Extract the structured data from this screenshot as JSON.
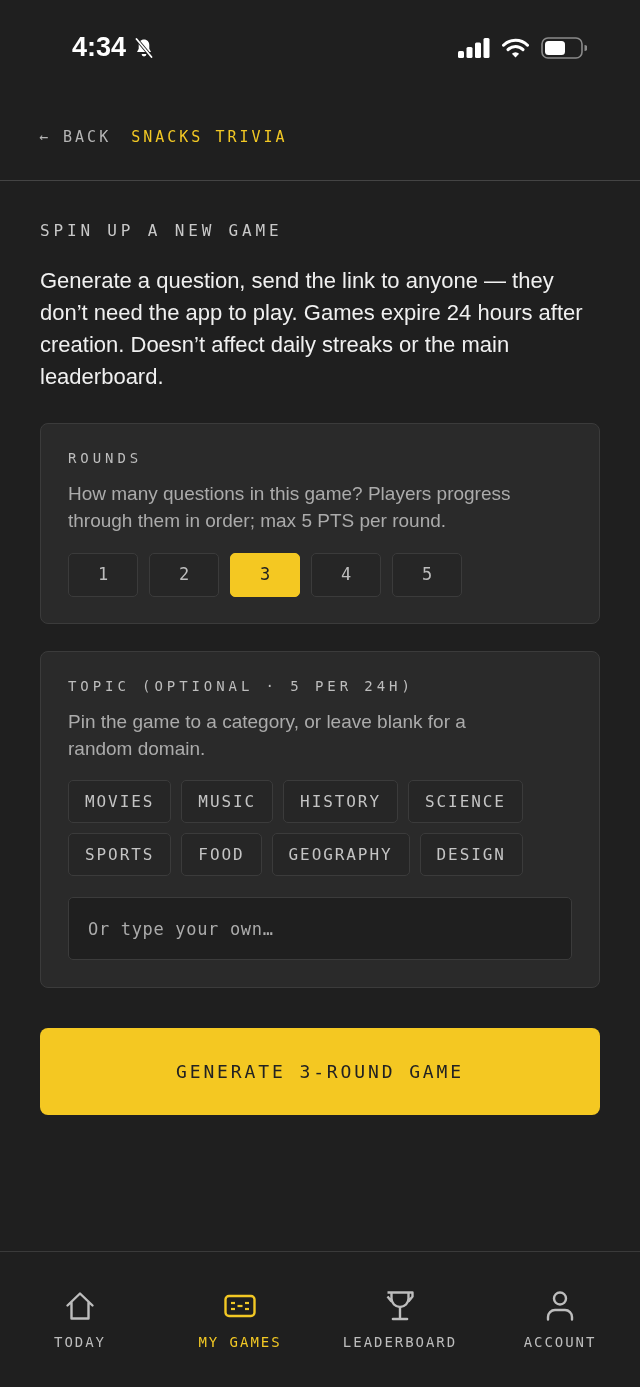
{
  "status_bar": {
    "time": "4:34"
  },
  "header": {
    "back": "← BACK",
    "title": "SNACKS TRIVIA"
  },
  "section_title": "SPIN UP A NEW GAME",
  "intro": "Generate a question, send the link to anyone — they don’t need the app to play. Games expire 24 hours after creation. Doesn’t affect daily streaks or the main leaderboard.",
  "rounds": {
    "label": "ROUNDS",
    "description": "How many questions in this game? Players progress through them in order; max 5 PTS per round.",
    "options": [
      {
        "label": "1",
        "selected": false
      },
      {
        "label": "2",
        "selected": false
      },
      {
        "label": "3",
        "selected": true
      },
      {
        "label": "4",
        "selected": false
      },
      {
        "label": "5",
        "selected": false
      }
    ]
  },
  "topic": {
    "label": "TOPIC (OPTIONAL · 5 PER 24H)",
    "description": "Pin the game to a category, or leave blank for a random domain.",
    "chips": [
      {
        "label": "MOVIES",
        "selected": false
      },
      {
        "label": "MUSIC",
        "selected": false
      },
      {
        "label": "HISTORY",
        "selected": false
      },
      {
        "label": "SCIENCE",
        "selected": false
      },
      {
        "label": "SPORTS",
        "selected": false
      },
      {
        "label": "FOOD",
        "selected": false
      },
      {
        "label": "GEOGRAPHY",
        "selected": false
      },
      {
        "label": "DESIGN",
        "selected": false
      }
    ],
    "input": {
      "placeholder": "Or type your own…"
    }
  },
  "generate_button": "GENERATE 3-ROUND GAME",
  "tab_bar": [
    {
      "label": "TODAY",
      "selected": false
    },
    {
      "label": "MY GAMES",
      "selected": true
    },
    {
      "label": "LEADERBOARD",
      "selected": false
    },
    {
      "label": "ACCOUNT",
      "selected": false
    }
  ]
}
